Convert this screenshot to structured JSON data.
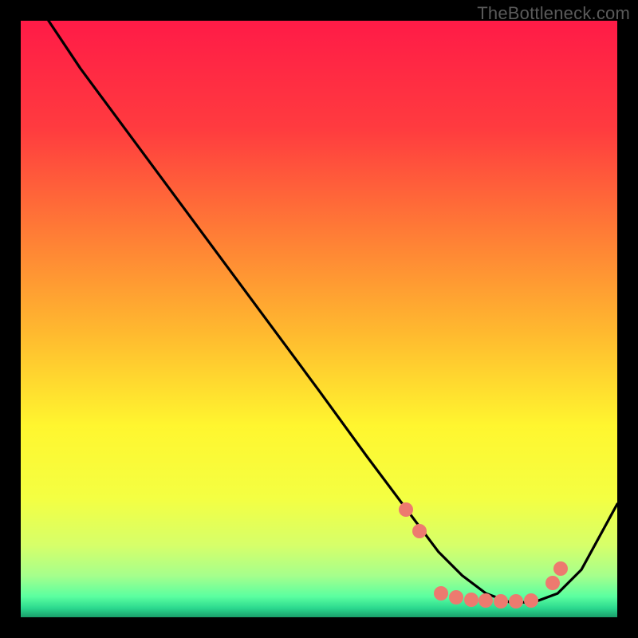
{
  "watermark": "TheBottleneck.com",
  "gradient_stops": [
    {
      "offset": 0.0,
      "color": "#ff1b47"
    },
    {
      "offset": 0.18,
      "color": "#ff3b3f"
    },
    {
      "offset": 0.35,
      "color": "#ff7a36"
    },
    {
      "offset": 0.52,
      "color": "#ffb82f"
    },
    {
      "offset": 0.68,
      "color": "#fff62f"
    },
    {
      "offset": 0.8,
      "color": "#f4ff42"
    },
    {
      "offset": 0.88,
      "color": "#d6ff6a"
    },
    {
      "offset": 0.93,
      "color": "#a6ff8c"
    },
    {
      "offset": 0.965,
      "color": "#5bffa0"
    },
    {
      "offset": 0.985,
      "color": "#2bd88e"
    },
    {
      "offset": 1.0,
      "color": "#1a9e6a"
    }
  ],
  "dot_color": "#ed7a6f",
  "chart_data": {
    "type": "line",
    "title": "",
    "xlabel": "",
    "ylabel": "",
    "xlim": [
      0,
      100
    ],
    "ylim": [
      0,
      100
    ],
    "series": [
      {
        "name": "curve",
        "x": [
          0,
          4,
          10,
          20,
          30,
          40,
          50,
          58,
          64,
          70,
          74,
          78,
          82,
          86,
          90,
          94,
          100
        ],
        "y": [
          110,
          101,
          92,
          78.5,
          65,
          51.5,
          38,
          27,
          19,
          11,
          7,
          4,
          2.5,
          2.5,
          4,
          8,
          19
        ]
      }
    ],
    "markers": {
      "name": "dots",
      "x": [
        64.5,
        66.8,
        70.5,
        73.0,
        75.5,
        78.0,
        80.5,
        83.0,
        85.5,
        89.2,
        90.5
      ],
      "y": [
        18.0,
        14.5,
        4.0,
        3.4,
        3.0,
        2.8,
        2.7,
        2.7,
        2.8,
        5.8,
        8.2
      ]
    }
  }
}
